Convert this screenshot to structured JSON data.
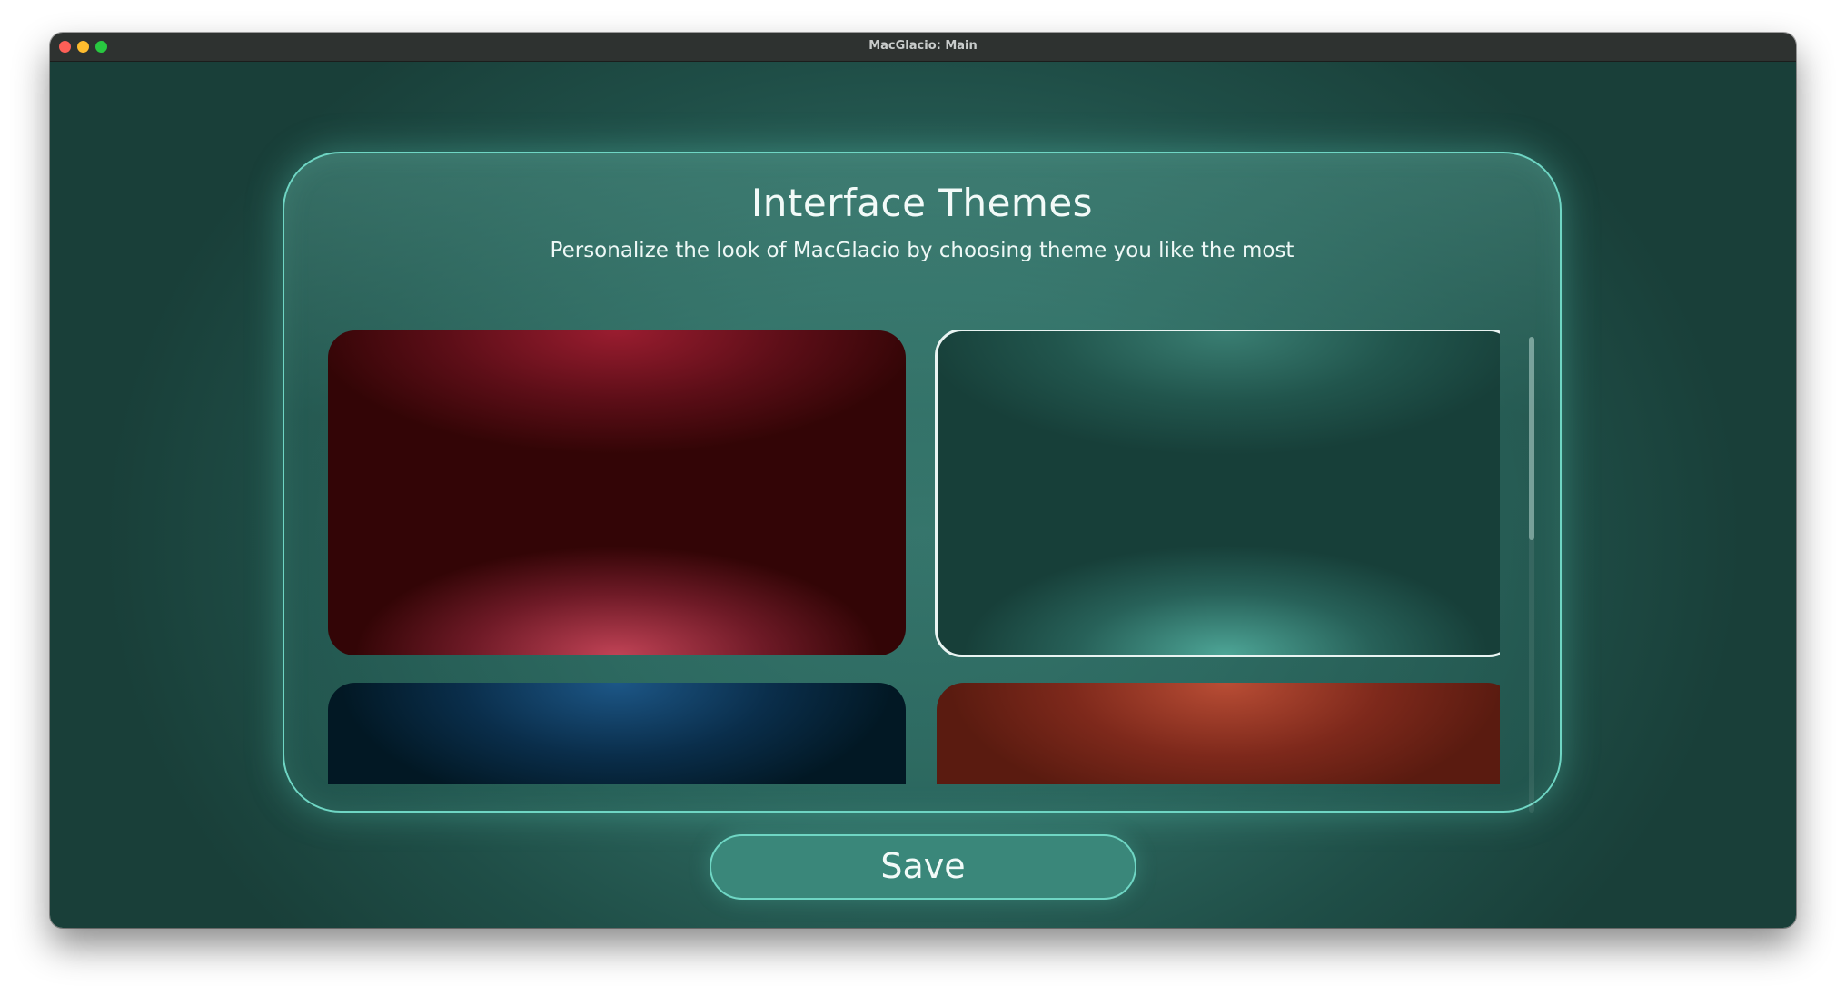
{
  "window": {
    "title": "MacGlacio: Main"
  },
  "panel": {
    "title": "Interface Themes",
    "subtitle": "Personalize the look of MacGlacio by choosing theme you like the most"
  },
  "themes": [
    {
      "id": "red",
      "color": "#8a1a2a",
      "selected": false
    },
    {
      "id": "teal",
      "color": "#2f6b62",
      "selected": true
    },
    {
      "id": "blue",
      "color": "#0f3c5e",
      "selected": false
    },
    {
      "id": "orange",
      "color": "#a83a25",
      "selected": false
    }
  ],
  "scroll": {
    "position_fraction": 0.0,
    "visible_fraction": 0.43
  },
  "actions": {
    "save_label": "Save"
  },
  "colors": {
    "accent": "#6fd6c4",
    "button_fill": "#3a877a",
    "background": "#2f6b62"
  }
}
